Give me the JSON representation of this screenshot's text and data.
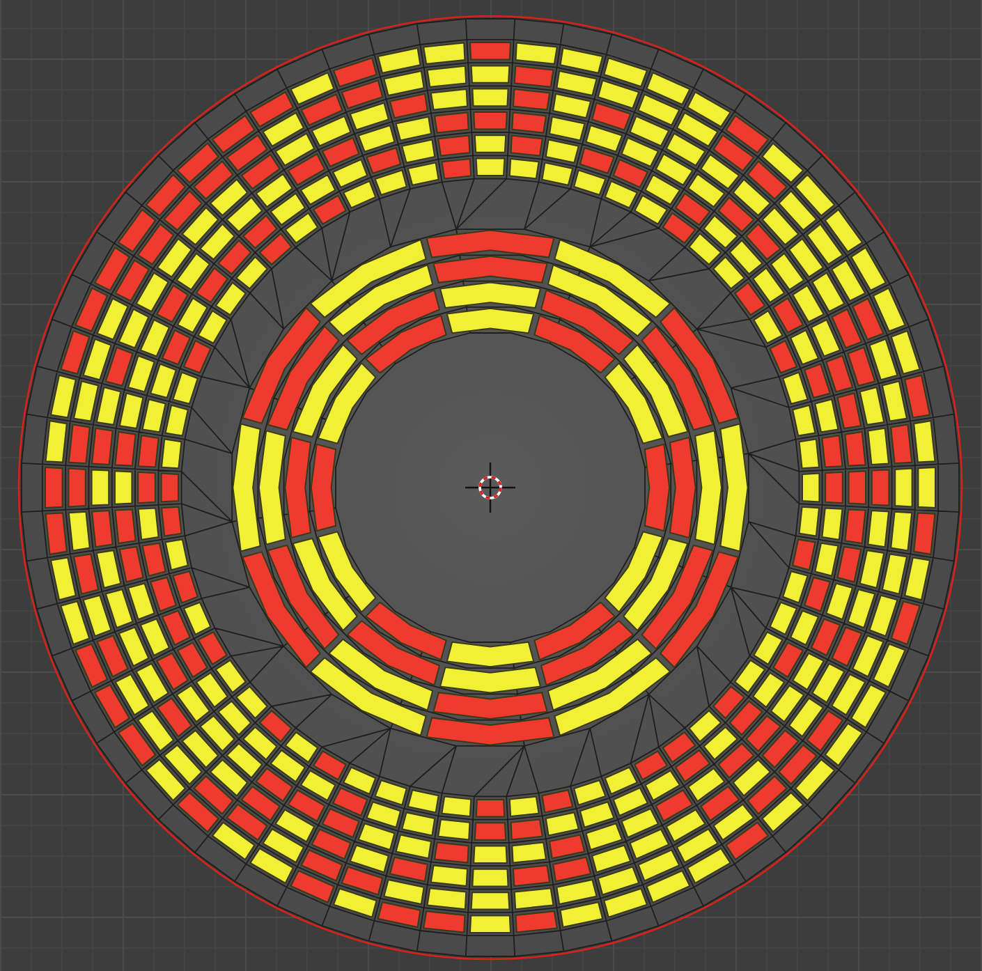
{
  "viewport": {
    "grid": true
  },
  "palette": [
    {
      "color": "#ef3b2f"
    },
    {
      "color": "#f2f035"
    }
  ],
  "mesh": {
    "cursor": true
  }
}
